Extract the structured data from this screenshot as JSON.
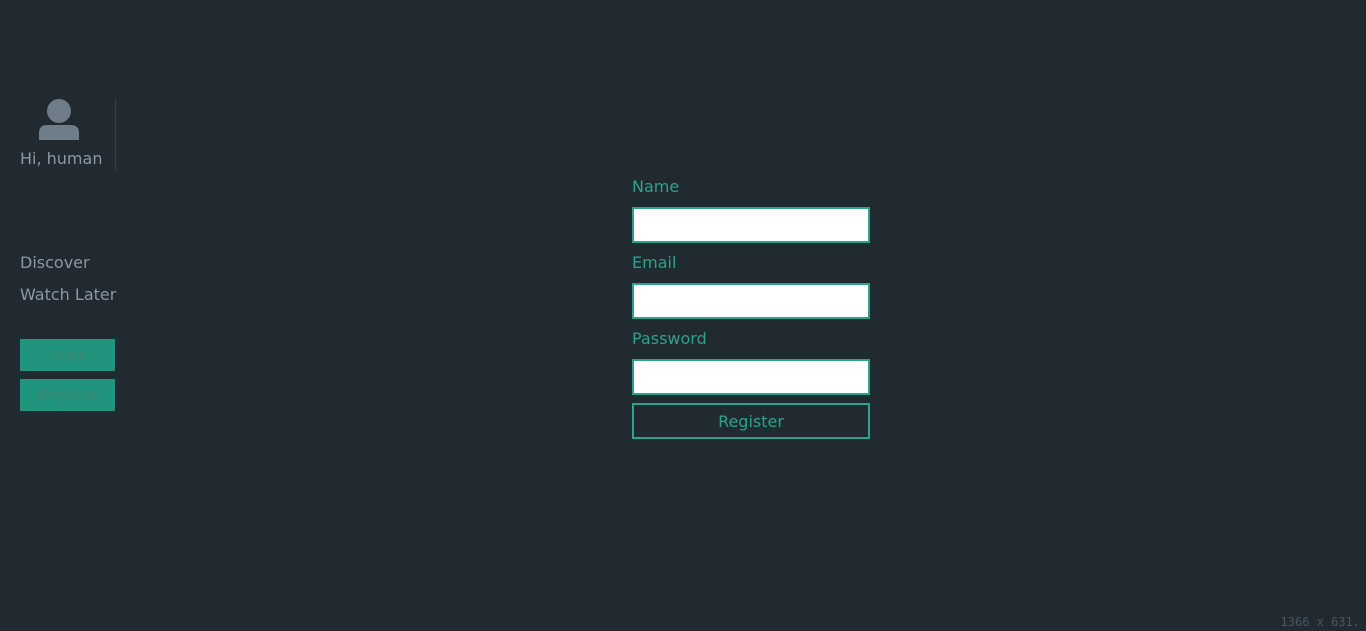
{
  "sidebar": {
    "avatar_icon": "user-icon",
    "greeting": "Hi, human",
    "nav": [
      {
        "label": "Discover"
      },
      {
        "label": "Watch Later"
      }
    ],
    "login_label": "Login",
    "register_label": "Register"
  },
  "form": {
    "name_label": "Name",
    "name_value": "",
    "email_label": "Email",
    "email_value": "",
    "password_label": "Password",
    "password_value": "",
    "submit_label": "Register"
  },
  "overlay": {
    "dimensions": "1366 x 631."
  },
  "colors": {
    "background": "#212a31",
    "accent": "#2aa38a",
    "muted_text": "#8a97a4",
    "button_fill": "#21947d"
  }
}
